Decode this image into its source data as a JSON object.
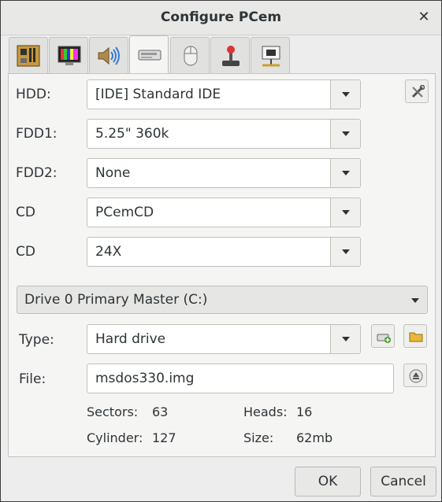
{
  "window": {
    "title": "Configure PCem"
  },
  "tabs": [
    {
      "icon": "motherboard-icon"
    },
    {
      "icon": "display-icon"
    },
    {
      "icon": "sound-icon"
    },
    {
      "icon": "drive-icon"
    },
    {
      "icon": "mouse-icon"
    },
    {
      "icon": "joystick-icon"
    },
    {
      "icon": "network-icon"
    }
  ],
  "active_tab": 3,
  "storage": {
    "hdd_label": "HDD:",
    "hdd_value": "[IDE] Standard IDE",
    "fdd1_label": "FDD1:",
    "fdd1_value": "5.25\" 360k",
    "fdd2_label": "FDD2:",
    "fdd2_value": "None",
    "cd_label": "CD",
    "cd_value": "PCemCD",
    "cd2_label": "CD",
    "cd2_value": "24X"
  },
  "drive": {
    "selector_value": "Drive 0 Primary Master (C:)",
    "type_label": "Type:",
    "type_value": "Hard drive",
    "file_label": "File:",
    "file_value": "msdos330.img",
    "sectors_label": "Sectors:",
    "sectors_value": "63",
    "heads_label": "Heads:",
    "heads_value": "16",
    "cylinder_label": "Cylinder:",
    "cylinder_value": "127",
    "size_label": "Size:",
    "size_value": "62mb"
  },
  "buttons": {
    "ok": "OK",
    "cancel": "Cancel"
  }
}
